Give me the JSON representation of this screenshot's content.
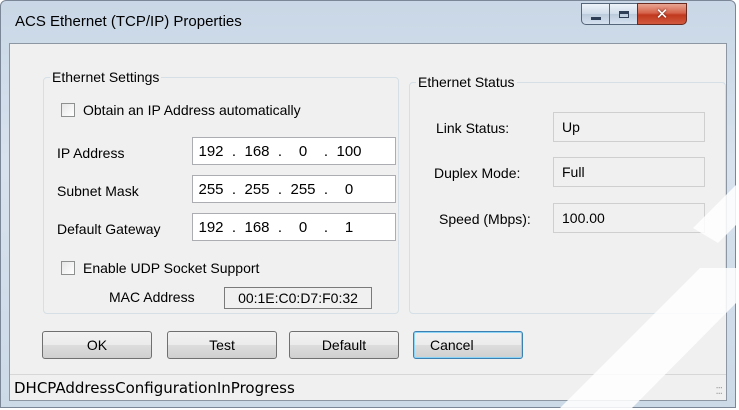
{
  "window": {
    "title": "ACS Ethernet (TCP/IP) Properties",
    "controls": [
      "minimize-icon",
      "maximize-icon",
      "close-icon"
    ]
  },
  "settings": {
    "legend": "Ethernet Settings",
    "obtain_auto_label": "Obtain an IP Address automatically",
    "obtain_auto_checked": false,
    "ip_label": "IP Address",
    "ip": [
      "192",
      "168",
      "0",
      "100"
    ],
    "subnet_label": "Subnet Mask",
    "subnet": [
      "255",
      "255",
      "255",
      "0"
    ],
    "gateway_label": "Default Gateway",
    "gateway": [
      "192",
      "168",
      "0",
      "1"
    ],
    "udp_label": "Enable UDP Socket Support",
    "udp_checked": false,
    "mac_label": "MAC Address",
    "mac_value": "00:1E:C0:D7:F0:32"
  },
  "status": {
    "legend": "Ethernet Status",
    "link_label": "Link Status:",
    "link_value": "Up",
    "duplex_label": "Duplex Mode:",
    "duplex_value": "Full",
    "speed_label": "Speed (Mbps):",
    "speed_value": "100.00"
  },
  "buttons": {
    "ok": "OK",
    "test": "Test",
    "default": "Default",
    "cancel": "Cancel"
  },
  "statusbar": {
    "text": "DHCPAddressConfigurationInProgress"
  },
  "colors": {
    "title_bar": "#d8e2ee",
    "close_button": "#c0391e",
    "dialog_bg": "#f0f0f0",
    "default_button_border": "#3c7fb1"
  }
}
